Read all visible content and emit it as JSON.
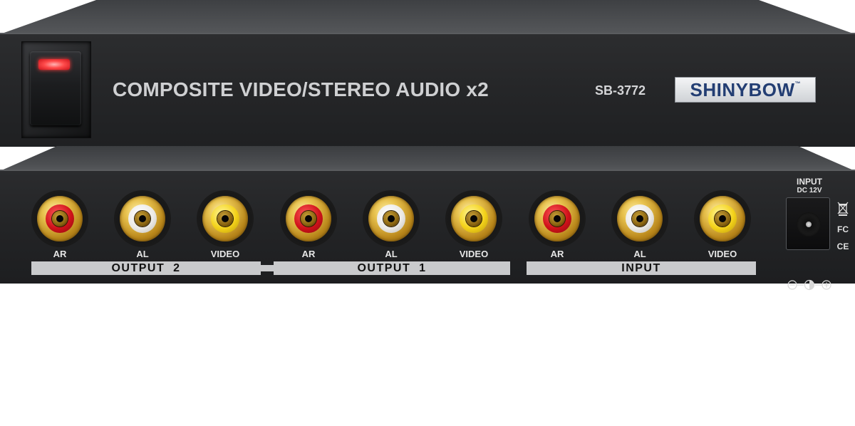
{
  "front_panel": {
    "title": "COMPOSITE VIDEO/STEREO AUDIO x2",
    "model": "SB-3772",
    "brand": "SHINYBOW",
    "brand_tm": "™",
    "power_led_color": "#ff3b3b"
  },
  "rear_panel": {
    "groups": [
      {
        "label": "OUTPUT  2",
        "jacks": [
          {
            "label": "AR",
            "color": "red"
          },
          {
            "label": "AL",
            "color": "white"
          },
          {
            "label": "VIDEO",
            "color": "yellow"
          }
        ]
      },
      {
        "label": "OUTPUT  1",
        "jacks": [
          {
            "label": "AR",
            "color": "red"
          },
          {
            "label": "AL",
            "color": "white"
          },
          {
            "label": "VIDEO",
            "color": "yellow"
          }
        ]
      },
      {
        "label": "INPUT",
        "jacks": [
          {
            "label": "AR",
            "color": "red"
          },
          {
            "label": "AL",
            "color": "white"
          },
          {
            "label": "VIDEO",
            "color": "yellow"
          }
        ]
      }
    ],
    "power_input": {
      "line1": "INPUT",
      "line2": "DC 12V"
    },
    "certifications": {
      "fc": "FC",
      "ce": "CE",
      "weee": "weee-bin-icon"
    },
    "polarity": "⊖-◐-⊕"
  },
  "colors": {
    "chassis": "#232426",
    "label_bar": "#c9cacc",
    "brand_blue": "#233e73"
  }
}
